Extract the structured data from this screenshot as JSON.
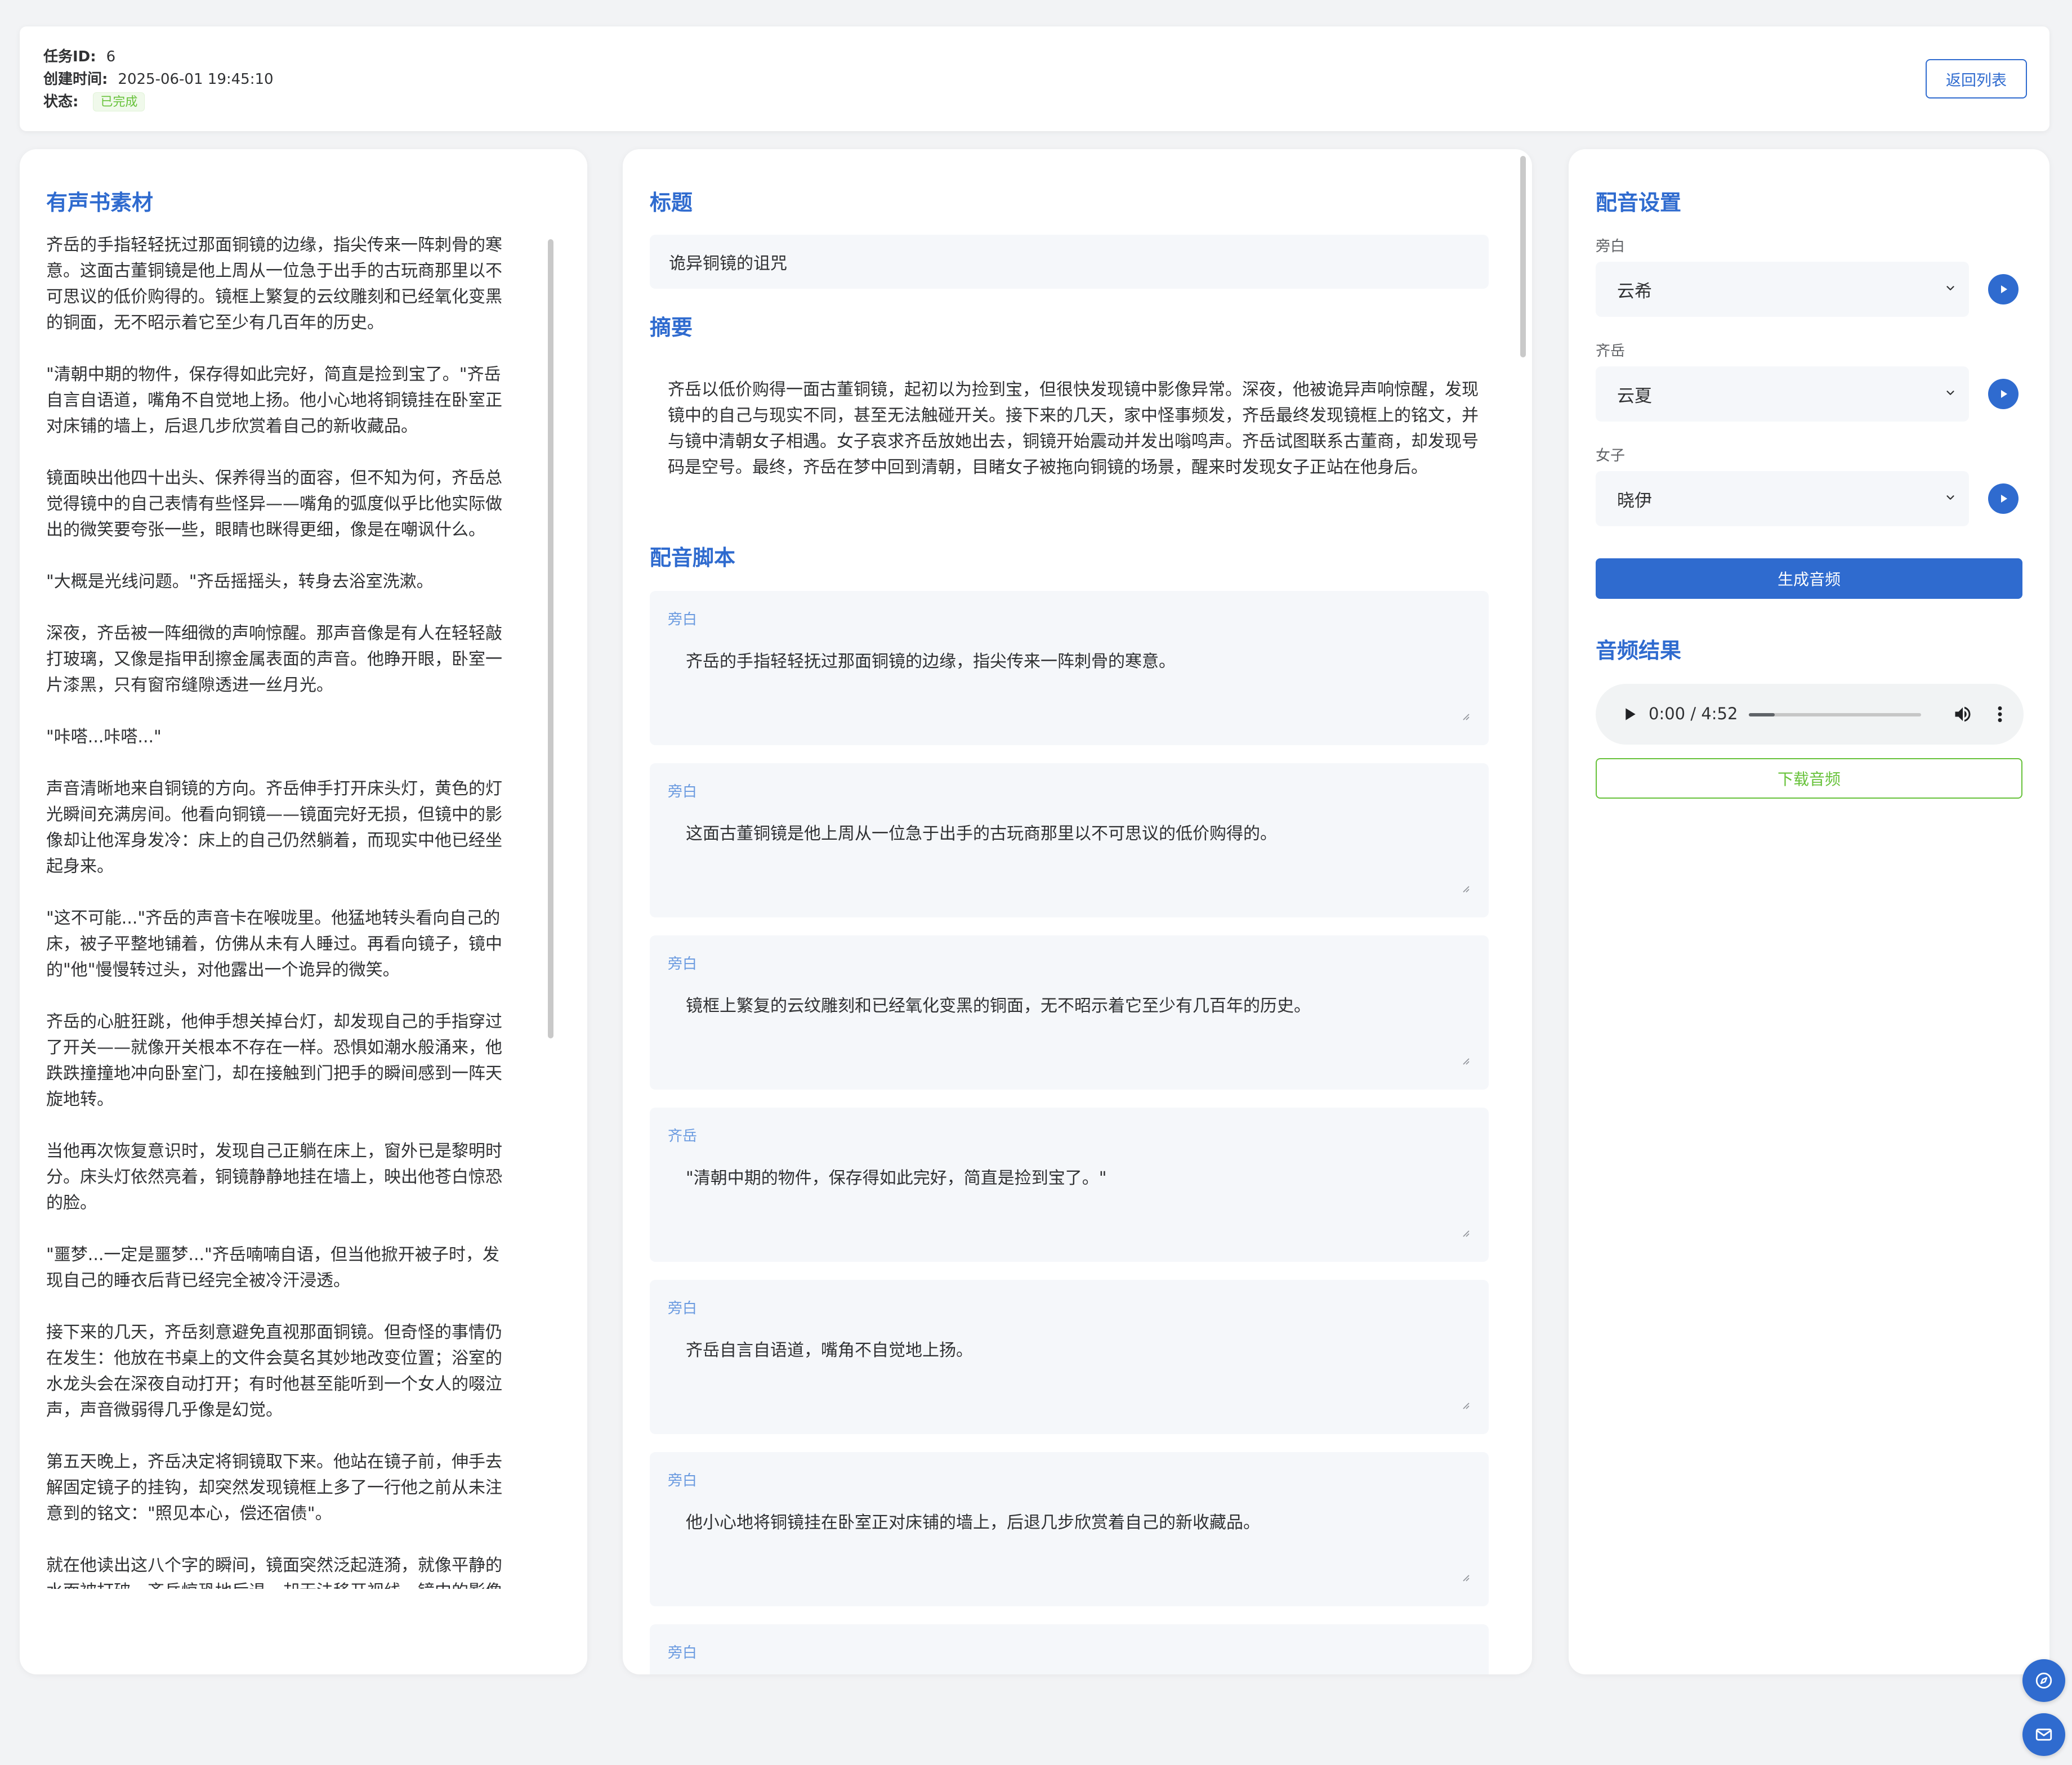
{
  "header": {
    "task_id_label": "任务ID:",
    "task_id_value": "6",
    "created_label": "创建时间:",
    "created_value": "2025-06-01 19:45:10",
    "status_label": "状态:",
    "status_value": "已完成",
    "back_button": "返回列表"
  },
  "source": {
    "title": "有声书素材",
    "paragraphs": [
      "齐岳的手指轻轻抚过那面铜镜的边缘，指尖传来一阵刺骨的寒意。这面古董铜镜是他上周从一位急于出手的古玩商那里以不可思议的低价购得的。镜框上繁复的云纹雕刻和已经氧化变黑的铜面，无不昭示着它至少有几百年的历史。",
      "\"清朝中期的物件，保存得如此完好，简直是捡到宝了。\"齐岳自言自语道，嘴角不自觉地上扬。他小心地将铜镜挂在卧室正对床铺的墙上，后退几步欣赏着自己的新收藏品。",
      "镜面映出他四十出头、保养得当的面容，但不知为何，齐岳总觉得镜中的自己表情有些怪异——嘴角的弧度似乎比他实际做出的微笑要夸张一些，眼睛也眯得更细，像是在嘲讽什么。",
      "\"大概是光线问题。\"齐岳摇摇头，转身去浴室洗漱。",
      "深夜，齐岳被一阵细微的声响惊醒。那声音像是有人在轻轻敲打玻璃，又像是指甲刮擦金属表面的声音。他睁开眼，卧室一片漆黑，只有窗帘缝隙透进一丝月光。",
      "\"咔嗒...咔嗒...\"",
      "声音清晰地来自铜镜的方向。齐岳伸手打开床头灯，黄色的灯光瞬间充满房间。他看向铜镜——镜面完好无损，但镜中的影像却让他浑身发冷：床上的自己仍然躺着，而现实中他已经坐起身来。",
      "\"这不可能...\"齐岳的声音卡在喉咙里。他猛地转头看向自己的床，被子平整地铺着，仿佛从未有人睡过。再看向镜子，镜中的\"他\"慢慢转过头，对他露出一个诡异的微笑。",
      "齐岳的心脏狂跳，他伸手想关掉台灯，却发现自己的手指穿过了开关——就像开关根本不存在一样。恐惧如潮水般涌来，他跌跌撞撞地冲向卧室门，却在接触到门把手的瞬间感到一阵天旋地转。",
      "当他再次恢复意识时，发现自己正躺在床上，窗外已是黎明时分。床头灯依然亮着，铜镜静静地挂在墙上，映出他苍白惊恐的脸。",
      "\"噩梦...一定是噩梦...\"齐岳喃喃自语，但当他掀开被子时，发现自己的睡衣后背已经完全被冷汗浸透。",
      "接下来的几天，齐岳刻意避免直视那面铜镜。但奇怪的事情仍在发生：他放在书桌上的文件会莫名其妙地改变位置；浴室的水龙头会在深夜自动打开；有时他甚至能听到一个女人的啜泣声，声音微弱得几乎像是幻觉。",
      "第五天晚上，齐岳决定将铜镜取下来。他站在镜子前，伸手去解固定镜子的挂钩，却突然发现镜框上多了一行他之前从未注意到的铭文：\"照见本心，偿还宿债\"。",
      "就在他读出这八个字的瞬间，镜面突然泛起涟漪，就像平静的水面被打破。齐岳惊恐地后退，却无法移开视线。镜中的影像扭曲变形，最后定格在一个陌生的场景：一间点着红烛的古代闺房，一个穿着清朝服饰的年轻女子背对着他坐在梳妆台前。"
    ]
  },
  "middle": {
    "title_heading": "标题",
    "title_value": "诡异铜镜的诅咒",
    "summary_heading": "摘要",
    "summary_text": "齐岳以低价购得一面古董铜镜，起初以为捡到宝，但很快发现镜中影像异常。深夜，他被诡异声响惊醒，发现镜中的自己与现实不同，甚至无法触碰开关。接下来的几天，家中怪事频发，齐岳最终发现镜框上的铭文，并与镜中清朝女子相遇。女子哀求齐岳放她出去，铜镜开始震动并发出嗡鸣声。齐岳试图联系古董商，却发现号码是空号。最终，齐岳在梦中回到清朝，目睹女子被拖向铜镜的场景，醒来时发现女子正站在他身后。",
    "script_heading": "配音脚本",
    "script_items": [
      {
        "speaker": "旁白",
        "text": "齐岳的手指轻轻抚过那面铜镜的边缘，指尖传来一阵刺骨的寒意。"
      },
      {
        "speaker": "旁白",
        "text": "这面古董铜镜是他上周从一位急于出手的古玩商那里以不可思议的低价购得的。"
      },
      {
        "speaker": "旁白",
        "text": "镜框上繁复的云纹雕刻和已经氧化变黑的铜面，无不昭示着它至少有几百年的历史。"
      },
      {
        "speaker": "齐岳",
        "text": "\"清朝中期的物件，保存得如此完好，简直是捡到宝了。\""
      },
      {
        "speaker": "旁白",
        "text": "齐岳自言自语道，嘴角不自觉地上扬。"
      },
      {
        "speaker": "旁白",
        "text": "他小心地将铜镜挂在卧室正对床铺的墙上，后退几步欣赏着自己的新收藏品。"
      },
      {
        "speaker": "旁白",
        "text": ""
      }
    ]
  },
  "settings": {
    "heading": "配音设置",
    "voices": [
      {
        "role": "旁白",
        "voice": "云希"
      },
      {
        "role": "齐岳",
        "voice": "云夏"
      },
      {
        "role": "女子",
        "voice": "晓伊"
      }
    ],
    "generate_button": "生成音频",
    "result_heading": "音频结果",
    "audio_time": "0:00 / 4:52",
    "audio_progress": 0.15,
    "download_button": "下载音频"
  },
  "colors": {
    "accent": "#2f6bcf",
    "success": "#67c23a",
    "speaker_label": "#6b9be0"
  }
}
